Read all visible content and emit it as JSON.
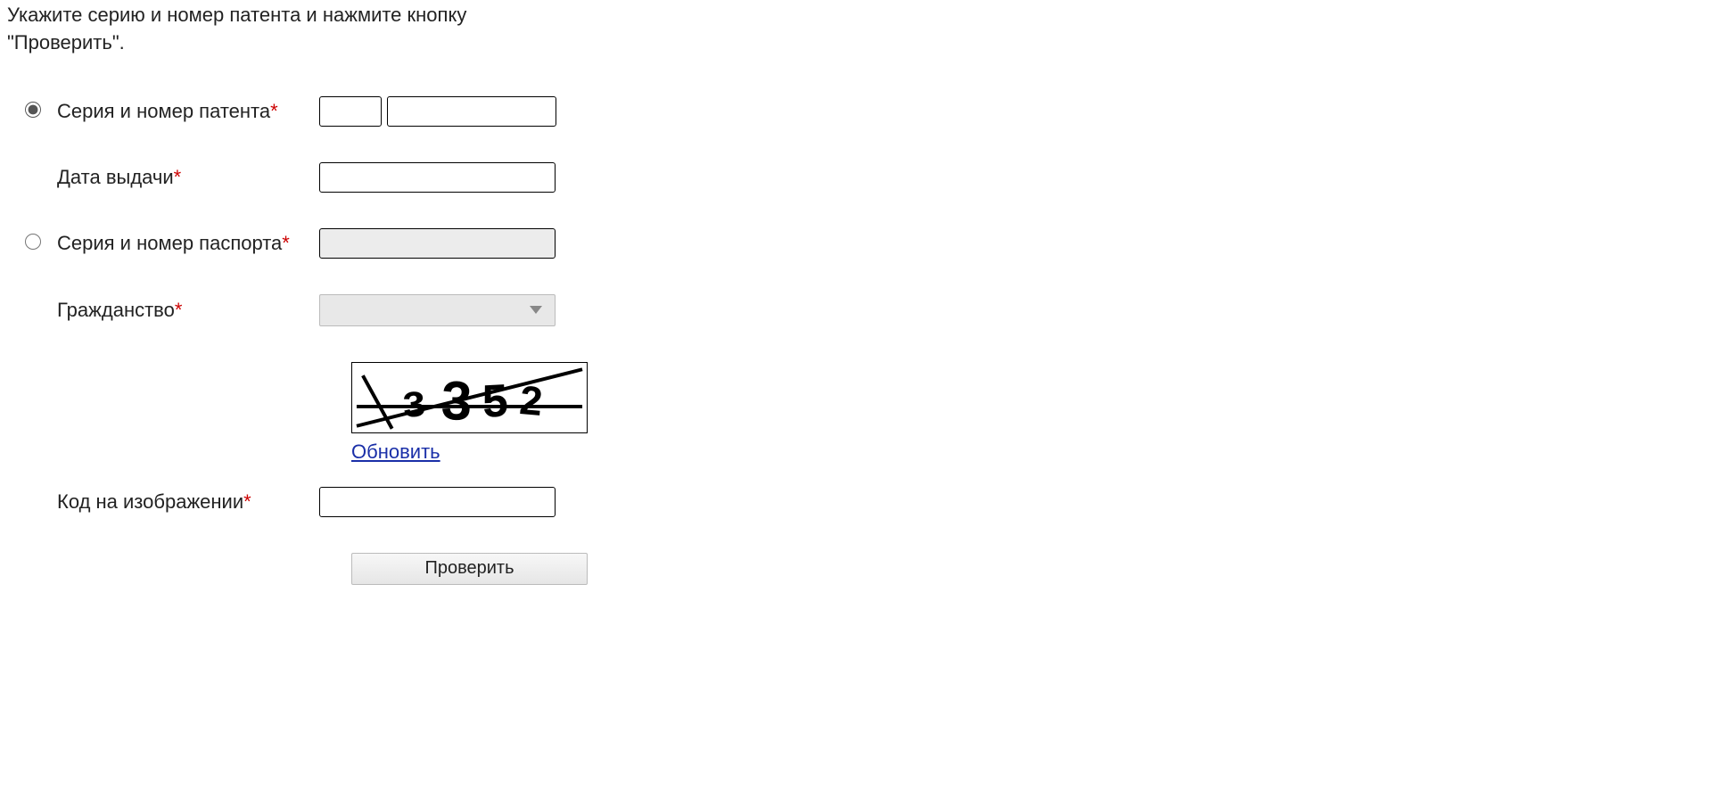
{
  "instructions": "Укажите серию и номер патента и нажмите кнопку \"Проверить\".",
  "form": {
    "patent": {
      "label": "Серия и номер патента",
      "series_value": "",
      "number_value": ""
    },
    "issue_date": {
      "label": "Дата выдачи",
      "value": ""
    },
    "passport": {
      "label": "Серия и номер паспорта",
      "value": ""
    },
    "citizenship": {
      "label": "Гражданство",
      "value": ""
    },
    "captcha": {
      "refresh_label": "Обновить",
      "code_label": "Код на изображении",
      "value": "",
      "display_text": "з352"
    },
    "submit_label": "Проверить"
  }
}
